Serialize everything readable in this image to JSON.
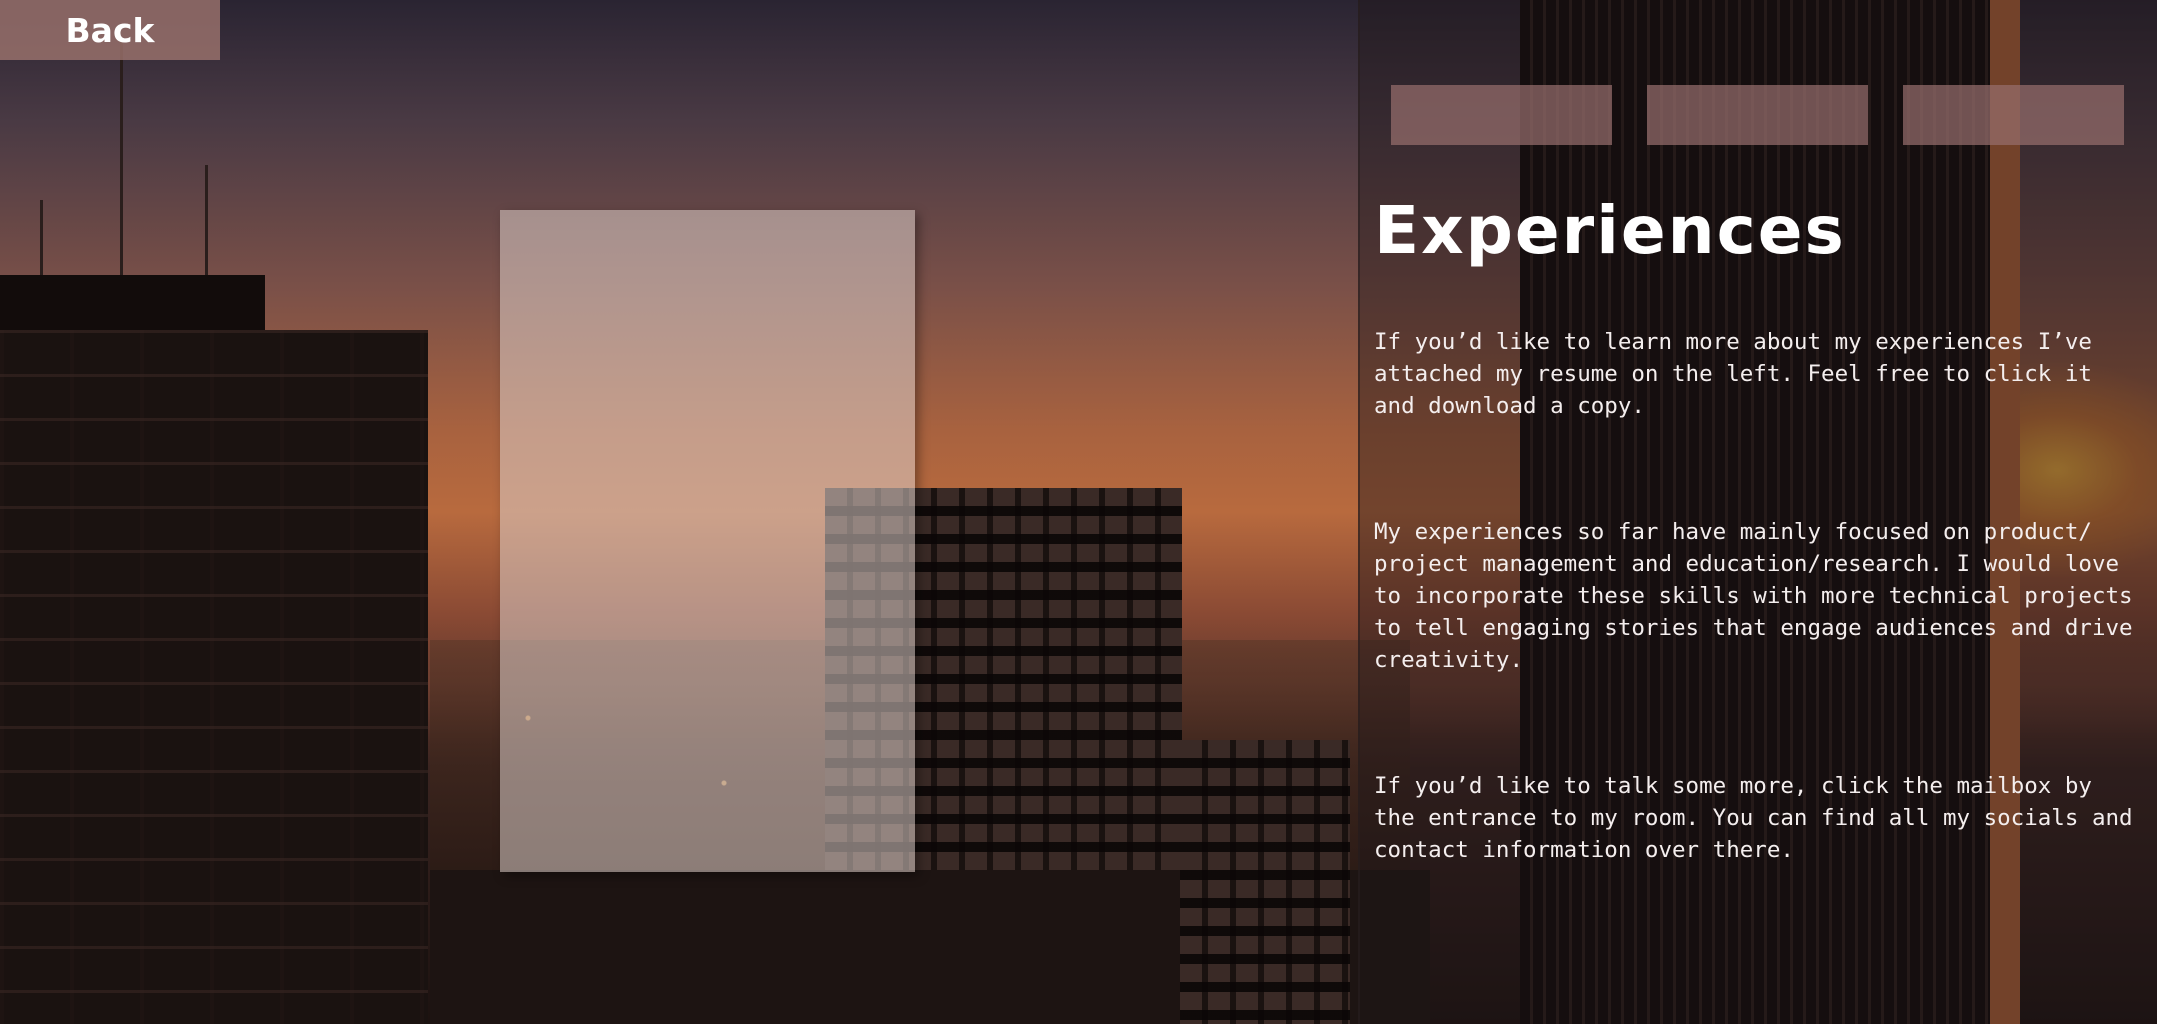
{
  "nav": {
    "back_label": "Back",
    "tabs": [
      "",
      "",
      ""
    ]
  },
  "main": {
    "title": "Experiences",
    "paragraphs": [
      "If you’d like to learn more about my experiences I’ve attached my resume on the left. Feel free to click it and download a copy.",
      "My experiences so far have mainly focused on product/ project management and education/research. I would love to incorporate these skills with more technical projects to tell engaging stories that engage audiences and drive creativity.",
      "If you’d like to talk some more, click the mailbox by the entrance to my room. You can find all my socials and contact information over there."
    ]
  },
  "colors": {
    "button_bg": "#a07670",
    "tab_bg": "#966e6c",
    "text": "#ffffff"
  },
  "icons": {
    "background": "city-sunset-background"
  }
}
